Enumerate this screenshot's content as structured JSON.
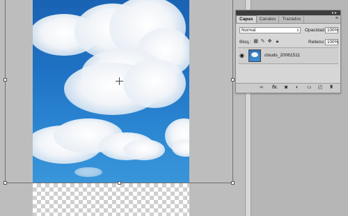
{
  "canvas": {
    "document_name": "clouds_20061511"
  },
  "layers_panel": {
    "tabs": [
      "Capas",
      "Canales",
      "Trazados"
    ],
    "active_tab": "Capas",
    "blend_mode": "Normal",
    "opacity_label": "Opacidad:",
    "opacity_value": "100%",
    "lock_label": "Bloq.:",
    "fill_label": "Relleno:",
    "fill_value": "100%",
    "layers": [
      {
        "name": "clouds_20061511",
        "visible": true
      }
    ],
    "bottom_icons": [
      "link-icon",
      "fx-icon",
      "mask-icon",
      "adjustment-icon",
      "group-folder-icon",
      "new-layer-icon",
      "trash-icon"
    ]
  },
  "colors": {
    "workspace": "#bdbdbd",
    "panel_bg": "#d6d6d6",
    "sky": "#1f73c4"
  }
}
